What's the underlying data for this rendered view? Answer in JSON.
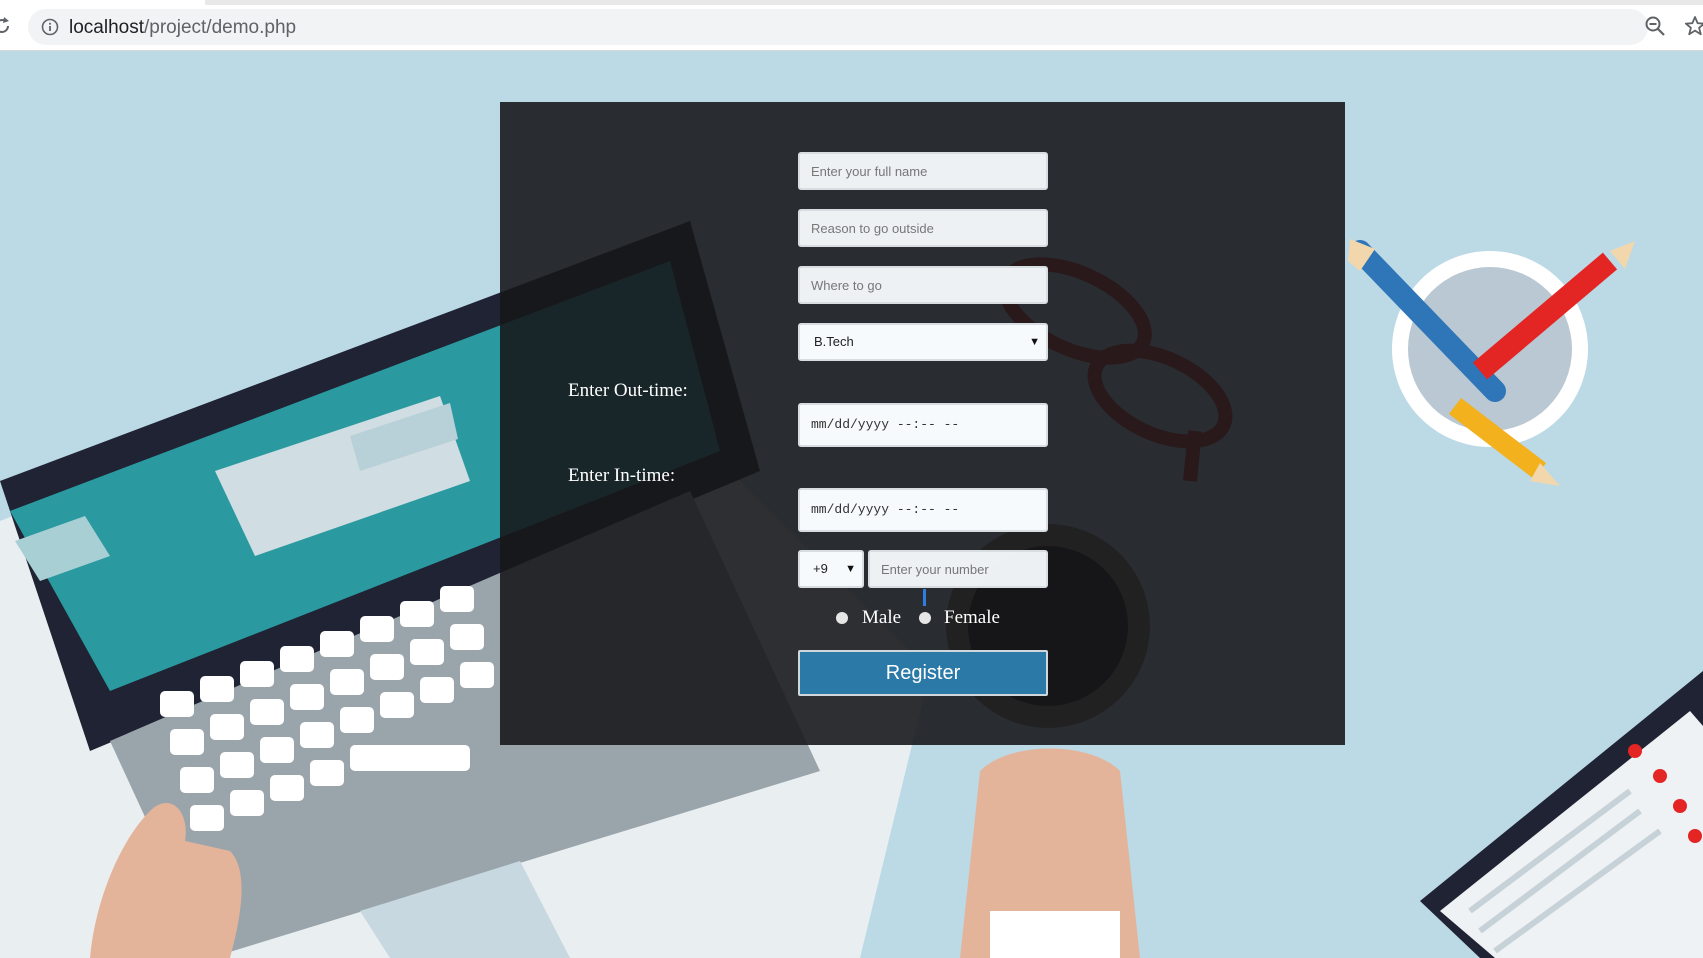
{
  "browser": {
    "url_host": "localhost",
    "url_path": "/project/demo.php"
  },
  "form": {
    "name_placeholder": "Enter your full name",
    "reason_placeholder": "Reason to go outside",
    "where_placeholder": "Where to go",
    "course_selected": "B.Tech",
    "outtime_label": "Enter Out-time:",
    "outtime_value": "mm/dd/yyyy --:-- --",
    "intime_label": "Enter In-time:",
    "intime_value": "mm/dd/yyyy --:-- --",
    "country_code": "+9",
    "phone_placeholder": "Enter your number",
    "gender_male": "Male",
    "gender_female": "Female",
    "register_label": "Register"
  },
  "colors": {
    "page_background": "#bcd9e6",
    "panel": "#16181a",
    "register_button": "#2a79a6"
  }
}
